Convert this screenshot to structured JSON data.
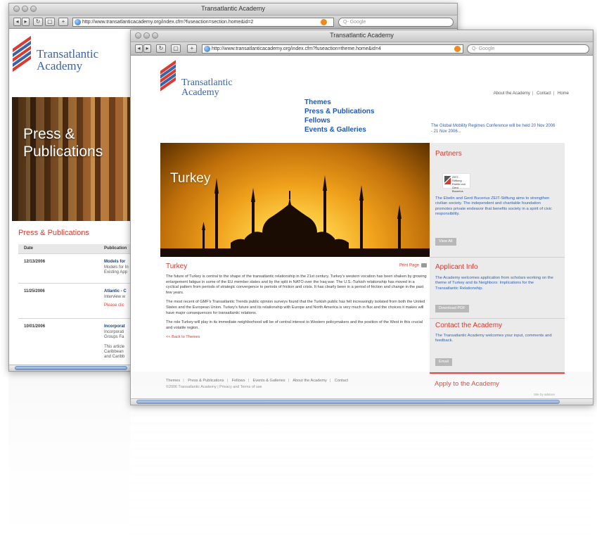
{
  "back_window": {
    "title": "Transatlantic Academy",
    "url": "http://www.transatlanticacademy.org/index.cfm?fuseaction=section.home&id=2",
    "search_placeholder": "Q- Google",
    "logo": {
      "line1": "Transatlantic",
      "line2": "Academy"
    },
    "hero_title_line1": "Press &",
    "hero_title_line2": "Publications",
    "section_title": "Press & Publications",
    "table_headers": {
      "date": "Date",
      "publication": "Publication"
    },
    "rows": [
      {
        "date": "12/13/2006",
        "title": "Models for",
        "sub1": "Models for In",
        "sub2": "Existing App"
      },
      {
        "date": "11/25/2006",
        "title": "Atlantic - C",
        "sub1": "Interview w",
        "sub2": "Please clic"
      },
      {
        "date": "10/01/2006",
        "title": "Incorporat",
        "sub1": "Incorporati",
        "sub2": "Groups Fa",
        "sub3": "This article",
        "sub4": "Caribbean",
        "sub5": "and Caribb"
      }
    ]
  },
  "front_window": {
    "title": "Transatlantic Academy",
    "url": "http://www.transatlanticacademy.org/index.cfm?fuseaction=theme.home&id=4",
    "search_placeholder": "Q- Google",
    "logo": {
      "line1": "Transatlantic",
      "line2": "Academy"
    },
    "nav": [
      "Themes",
      "Press & Publications",
      "Fellows",
      "Events & Galleries"
    ],
    "top_links": [
      "About the Academy",
      "Contact",
      "Home"
    ],
    "news_blurb": "The Global Mobility Regimes Conference will be held 20 Nov 2006 - 21 Nov 2006...",
    "hero_title": "Turkey",
    "article_title": "Turkey",
    "print_page": "Print Page",
    "paragraphs": [
      "The future of Turkey is central to the shape of the transatlantic relationship in the 21st century. Turkey's western vocation has been shaken by growing enlargement fatigue in some of the EU member states and by the split in NATO over the Iraq war. The U.S.-Turkish relationship has moved in a cyclical pattern from periods of strategic convergence to periods of friction and crisis. It has clearly been in a period of friction and change in the past few years.",
      "The most recent of GMF's Transatlantic Trends public opinion surveys found that the Turkish public has felt increasingly isolated from both the United States and the European Union. Turkey's future and its relationship with Europe and North America is very much in flux and the choices it makes will have major consequences for transatlantic relations.",
      "The role Turkey will play in its immediate neighborhood will be of central interest to Western policymakers and the position of the West in this crucial and volatile region."
    ],
    "back_link": "<< Back to Themes",
    "footer_links": [
      "Themes",
      "Press & Publications",
      "Fellows",
      "Events & Galleries",
      "About the Academy",
      "Contact"
    ],
    "copyright": "©2006 Transatlantic Academy | Privacy and Terms of use",
    "sidebar": {
      "partners": {
        "title": "Partners",
        "logo_text": "ZEIT-Stiftung Ebelin und Gerd Bucerius",
        "text": "The Ebelin and Gerd Bucerius ZEIT-Stiftung aims to strengthen civilian society. The independent and charitable foundation promotes private endeavor that benefits society in a spirit of civic responsibility.",
        "button": "View All"
      },
      "applicant": {
        "title": "Applicant Info",
        "text": "The Academy welcomes application from scholars working on the theme of Turkey and its Neighbors: Implications for the Transatlantic Relationship.",
        "button": "Download PDF"
      },
      "contact": {
        "title": "Contact the Academy",
        "text": "The Transatlantic Academy welcomes your input, comments and feedback.",
        "button": "Email"
      },
      "apply": {
        "title": "Apply to the Academy"
      }
    },
    "site_by": "Site by adstore"
  },
  "colors": {
    "accent_red": "#d93b30",
    "link_blue": "#1e57b8",
    "logo_blue": "#3a63a8",
    "sidebar_gray": "#ebebeb"
  }
}
